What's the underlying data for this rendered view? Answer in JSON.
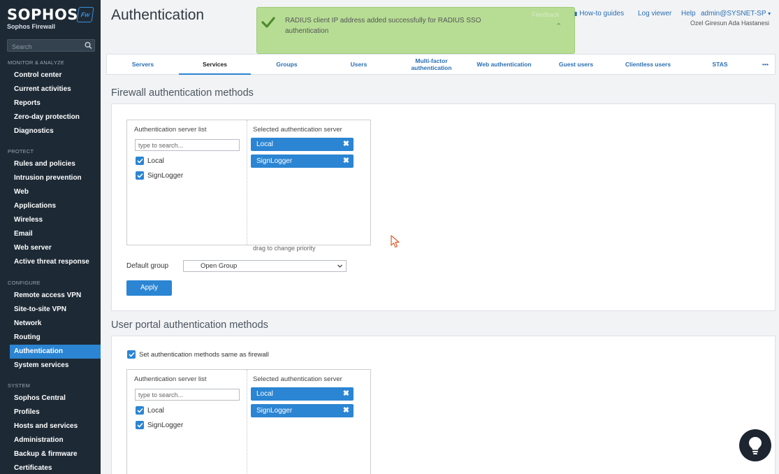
{
  "sidebar": {
    "brand": "SOPHOS",
    "brand_sub": "Sophos Firewall",
    "brand_badge": "Fw",
    "search_placeholder": "Search",
    "sections": [
      {
        "title": "MONITOR & ANALYZE",
        "items": [
          "Control center",
          "Current activities",
          "Reports",
          "Zero-day protection",
          "Diagnostics"
        ]
      },
      {
        "title": "PROTECT",
        "items": [
          "Rules and policies",
          "Intrusion prevention",
          "Web",
          "Applications",
          "Wireless",
          "Email",
          "Web server",
          "Active threat response"
        ]
      },
      {
        "title": "CONFIGURE",
        "items": [
          "Remote access VPN",
          "Site-to-site VPN",
          "Network",
          "Routing",
          "Authentication",
          "System services"
        ]
      },
      {
        "title": "SYSTEM",
        "items": [
          "Sophos Central",
          "Profiles",
          "Hosts and services",
          "Administration",
          "Backup & firmware",
          "Certificates"
        ]
      }
    ],
    "active_item": "Authentication"
  },
  "header": {
    "title": "Authentication",
    "feedback": "Feedback",
    "how_to": "How-to guides",
    "log_viewer": "Log viewer",
    "help": "Help",
    "user": "admin@SYSNET-SP",
    "org": "Ozel Giresun Ada Hastanesi"
  },
  "toast": {
    "message": "RADIUS client IP address added successfully for RADIUS SSO authentication",
    "color": "#b7dd95"
  },
  "tabs": [
    "Servers",
    "Services",
    "Groups",
    "Users",
    "Multi-factor authentication",
    "Web authentication",
    "Guest users",
    "Clientless users",
    "STAS",
    "•••"
  ],
  "active_tab": "Services",
  "firewall": {
    "title": "Firewall authentication methods",
    "list_header": "Authentication server list",
    "selected_header": "Selected authentication server",
    "search_placeholder": "type to search...",
    "servers": [
      "Local",
      "SignLogger"
    ],
    "selected": [
      "Local",
      "SignLogger"
    ],
    "drag_hint": "drag to change priority",
    "default_group_label": "Default group",
    "default_group_value": "Open Group",
    "apply": "Apply"
  },
  "portal": {
    "title": "User portal authentication methods",
    "same_as_firewall": "Set authentication methods same as firewall",
    "list_header": "Authentication server list",
    "selected_header": "Selected authentication server",
    "search_placeholder": "type to search...",
    "servers": [
      "Local",
      "SignLogger"
    ],
    "selected": [
      "Local",
      "SignLogger"
    ]
  },
  "colors": {
    "accent": "#2b85d3",
    "sidebar": "#1d2a36"
  }
}
